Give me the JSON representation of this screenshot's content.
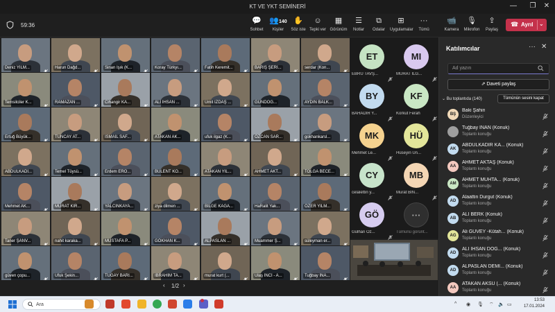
{
  "window": {
    "title": "KT VE YKT SEMİNERİ",
    "minimize": "—",
    "maximize": "❐",
    "close": "✕"
  },
  "toolbar": {
    "timer": "59:36",
    "chat": "Sohbet",
    "people": "Kişiler",
    "people_count": "140",
    "raise_hand": "Söz iste",
    "react": "Tepki ver",
    "view": "Görünüm",
    "notes": "Notlar",
    "rooms": "Odalar",
    "apps": "Uygulamalar",
    "more": "Tümü",
    "camera": "Kamera",
    "mic": "Mikrofon",
    "share": "Paylaş",
    "leave": "Ayrıl"
  },
  "grid": {
    "tiles": [
      "Deniz YILM...",
      "Harun Dağd...",
      "Sinan Işık (K...",
      "Koray Türkyı...",
      "Fatih Keremit...",
      "BARIŞ ŞERİ...",
      "serdar (Kon...",
      "Temsilciler K...",
      "RAMAZAN ...",
      "Cihangir KA...",
      "ALİ İHSAN ...",
      "Ümit İZDAŞ ...",
      "GÜNDOĞ...",
      "AYDIN BALK...",
      "Ertuğ Büyük...",
      "TUNCAY AT...",
      "İSMAİL SAF...",
      "ATAKAN AK...",
      "ufuk ilgaz (K...",
      "ÖZCAN SAR...",
      "gokhankarsl...",
      "ABDULKADİ...",
      "Temel Tüysü...",
      "Erdem ERO...",
      "BÜLENT KO...",
      "ATAKAN YIL...",
      "AHMET AKT...",
      "TOLGA BECE...",
      "Mehmet AK...",
      "MURAT KIR...",
      "YALCINKAYA...",
      "ziya dilmen ...",
      "BİLGE KAGA...",
      "HaRalit Yak...",
      "ÖZER YILM...",
      "Taner ŞANV...",
      "nahit karaka...",
      "MUSTAFA P...",
      "GÖKHAN K...",
      "ALPASLAN ...",
      "Muammer Ş...",
      "süleyman er...",
      "güven çopu...",
      "Ufuk Şekin...",
      "TUGAY BARI...",
      "İBRAHİM TA...",
      "murat kurt (...",
      "Ulaş İNCİ - A...",
      "Tuğbay İNA..."
    ],
    "pager": {
      "prev": "‹",
      "page": "1/2",
      "next": "›"
    }
  },
  "avatars": [
    {
      "initials": "ET",
      "name": "EBRU TAVŞ...",
      "color": "#c5e3c3"
    },
    {
      "initials": "MI",
      "name": "MURAT ILG...",
      "color": "#d9c9ef"
    },
    {
      "initials": "BY",
      "name": "BAHADIR Y...",
      "color": "#c2dbef"
    },
    {
      "initials": "KF",
      "name": "Korkut Ferah",
      "color": "#c9e7c4"
    },
    {
      "initials": "MK",
      "name": "Mehmet Le...",
      "color": "#f5d28f"
    },
    {
      "initials": "HÜ",
      "name": "Hüseyin Ün...",
      "color": "#e3e69a"
    },
    {
      "initials": "CY",
      "name": "celalettin y...",
      "color": "#c7e3ca"
    },
    {
      "initials": "MB",
      "name": "Murat BİN...",
      "color": "#f4d6b4"
    },
    {
      "initials": "GÖ",
      "name": "Gülhan Öz...",
      "color": "#d6ccef"
    },
    {
      "initials": "···",
      "name": "Tümünü görünt...",
      "color": "#2f2f2f"
    }
  ],
  "panel": {
    "title": "Katılımcılar",
    "more": "···",
    "close": "✕",
    "search_placeholder": "Ad yazın",
    "invite": "Daveti paylaş",
    "in_meeting": "Bu toplantıda (140)",
    "mute_all": "Tümünün sesini kapat",
    "people": [
      {
        "initials": "BŞ",
        "name": "Baki Şahin",
        "role": "Düzenleyici",
        "color": "#f1d9b8"
      },
      {
        "initials": "",
        "name": "Tuğbay İNAN (Konuk)",
        "role": "Toplantı konuğu",
        "color": "#9e9e9e"
      },
      {
        "initials": "AK",
        "name": "ABDULKADİR KA... (Konuk)",
        "role": "Toplantı konuğu",
        "color": "#c2dbef"
      },
      {
        "initials": "AA",
        "name": "AHMET AKTAŞ (Konuk)",
        "role": "Toplantı konuğu",
        "color": "#f4c9bf"
      },
      {
        "initials": "AM",
        "name": "AHMET MUHTA... (Konuk)",
        "role": "Toplantı konuğu",
        "color": "#c9e7c4"
      },
      {
        "initials": "AD",
        "name": "Alaattin Durgut (Konuk)",
        "role": "Toplantı konuğu",
        "color": "#c2dbef"
      },
      {
        "initials": "AB",
        "name": "ALİ BERK (Konuk)",
        "role": "Toplantı konuğu",
        "color": "#c2dbef"
      },
      {
        "initials": "AG",
        "name": "Ali GÜVEY -Kütah... (Konuk)",
        "role": "Toplantı konuğu",
        "color": "#e3e69a"
      },
      {
        "initials": "AD",
        "name": "ALİ İHSAN DOĞ... (Konuk)",
        "role": "Toplantı konuğu",
        "color": "#c2dbef"
      },
      {
        "initials": "AD",
        "name": "ALPASLAN DEMİ... (Konuk)",
        "role": "Toplantı konuğu",
        "color": "#c2dbef"
      },
      {
        "initials": "AA",
        "name": "ATAKAN AKSU (... (Konuk)",
        "role": "Toplantı konuğu",
        "color": "#f4c9bf"
      }
    ]
  },
  "taskbar": {
    "search_label": "Ara",
    "time": "13:53",
    "date": "17.01.2024",
    "tray_caret": "^"
  }
}
